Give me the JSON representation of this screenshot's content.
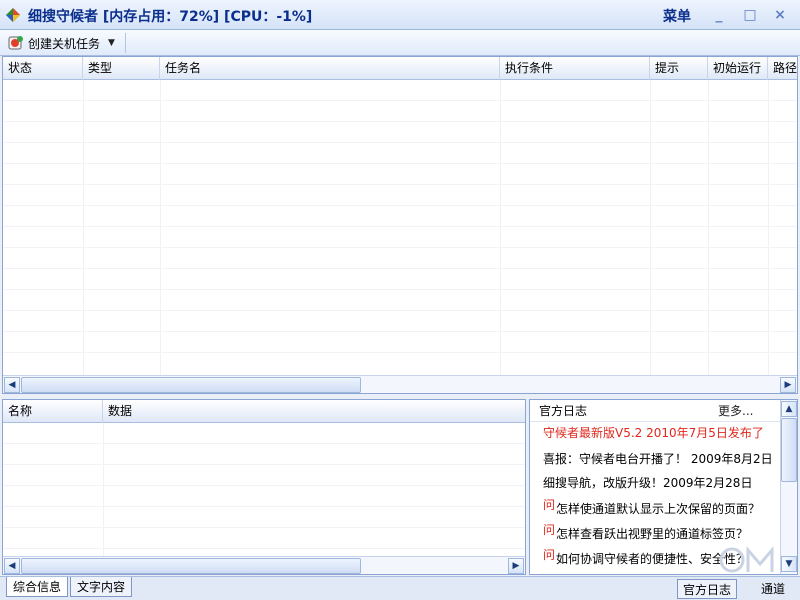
{
  "window": {
    "title": "细搜守候者 [内存占用：72%] [CPU：-1%]",
    "menu_label": "菜单",
    "buttons": [
      "_",
      "□",
      "×"
    ]
  },
  "toolbar": {
    "create_task_label": "创建关机任务"
  },
  "task_table": {
    "columns": [
      "状态",
      "类型",
      "任务名",
      "执行条件",
      "提示",
      "初始运行",
      "路径"
    ],
    "rows": []
  },
  "info_table": {
    "columns": [
      "名称",
      "数据"
    ],
    "rows": []
  },
  "news_panel": {
    "title": "官方日志",
    "more_label": "更多...",
    "items": [
      {
        "text": "守候者最新版V5.2 2010年7月5日发布了",
        "type": "red"
      },
      {
        "text": "喜报：守候者电台开播了！  2009年8月2日",
        "type": "normal"
      },
      {
        "text": "细搜导航，改版升级！2009年2月28日",
        "type": "normal"
      },
      {
        "prefix": "问",
        "text": "怎样使通道默认显示上次保留的页面？",
        "type": "question"
      },
      {
        "prefix": "问",
        "text": "怎样查看跃出视野里的通道标签页？",
        "type": "question"
      },
      {
        "prefix": "问",
        "text": "如何协调守候者的便捷性、安全性？",
        "type": "question"
      }
    ]
  },
  "bottom_tabs": [
    "综合信息",
    "文字内容"
  ],
  "status_bar": {
    "official_log_label": "官方日志",
    "channel_label": "通道"
  },
  "colors": {
    "title_text": "#0b2f8c",
    "accent_red": "#e0281e",
    "border_blue": "#8aa5d4"
  }
}
